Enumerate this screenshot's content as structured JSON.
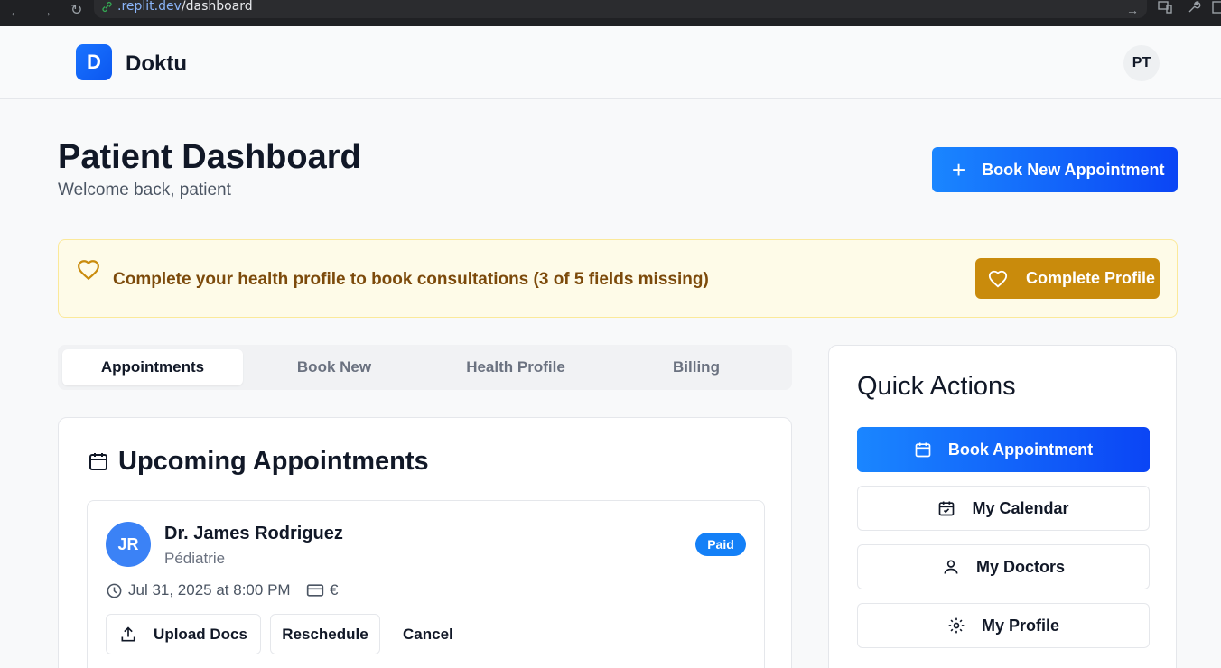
{
  "browser": {
    "url_domain": ".replit.dev",
    "url_path": "/dashboard"
  },
  "header": {
    "logo_letter": "D",
    "brand": "Doktu",
    "user_initials": "PT"
  },
  "page": {
    "title": "Patient Dashboard",
    "subtitle": "Welcome back, patient",
    "book_new_label": "Book New Appointment"
  },
  "banner": {
    "message": "Complete your health profile to book consultations (3 of 5 fields missing)",
    "button_label": "Complete Profile"
  },
  "tabs": [
    {
      "label": "Appointments",
      "active": true
    },
    {
      "label": "Book New",
      "active": false
    },
    {
      "label": "Health Profile",
      "active": false
    },
    {
      "label": "Billing",
      "active": false
    }
  ],
  "upcoming": {
    "title": "Upcoming Appointments",
    "appointment": {
      "initials": "JR",
      "doctor": "Dr. James Rodriguez",
      "specialty": "Pédiatrie",
      "status": "Paid",
      "datetime": "Jul 31, 2025 at 8:00 PM",
      "price": "€",
      "actions": {
        "upload": "Upload Docs",
        "reschedule": "Reschedule",
        "cancel": "Cancel"
      }
    }
  },
  "quick_actions": {
    "title": "Quick Actions",
    "book": "Book Appointment",
    "calendar": "My Calendar",
    "doctors": "My Doctors",
    "profile": "My Profile"
  },
  "colors": {
    "primary": "#1a73ff",
    "warning_bg": "#fefbe8",
    "warning_btn": "#c98b0c",
    "badge": "#1480f7"
  }
}
